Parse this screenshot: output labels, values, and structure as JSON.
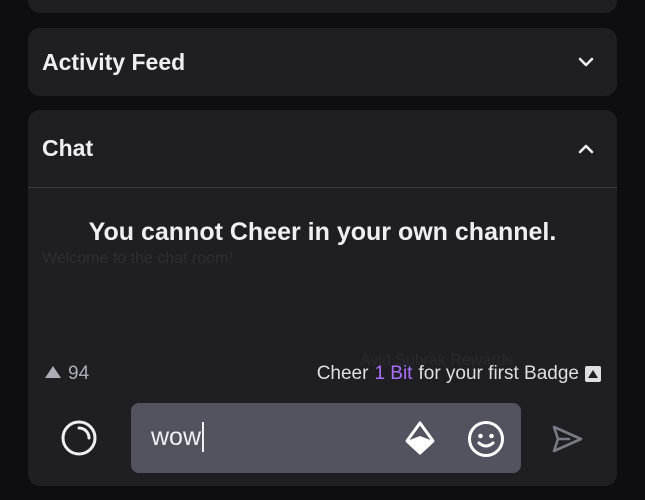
{
  "activity_feed": {
    "title": "Activity Feed"
  },
  "chat": {
    "title": "Chat",
    "ghost_message": "Welcome to the chat room!",
    "ghost_message_2": "Avid Subrak Rewards",
    "cheer_warning": "You cannot Cheer in your own channel.",
    "bits_balance": "94",
    "cheer_cta": {
      "prefix": "Cheer",
      "link": "1 Bit",
      "suffix": "for your first Badge"
    },
    "input": {
      "value": "wow"
    }
  },
  "colors": {
    "accent": "#a970ff",
    "panel": "#1f1f23",
    "input": "#53535f"
  }
}
